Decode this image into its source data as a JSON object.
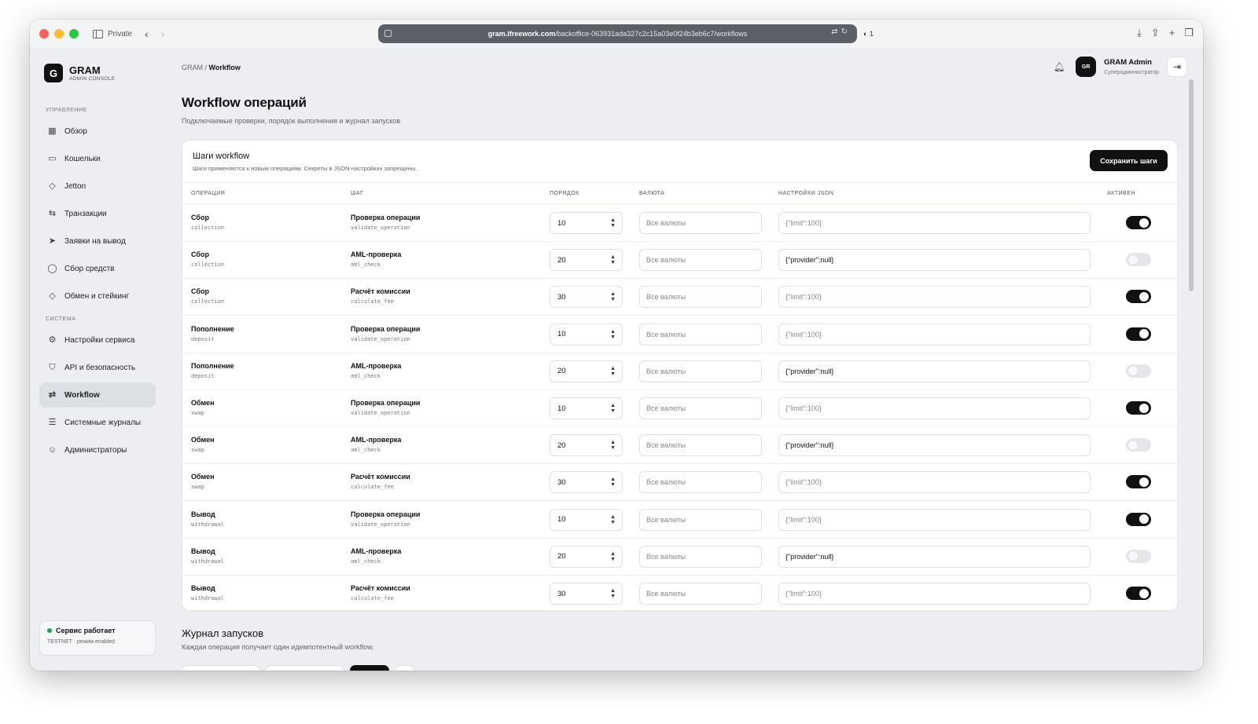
{
  "browser": {
    "tab_label": "Private",
    "url_host": "gram.ifreework.com",
    "url_path": "/backoffice-063931ada327c2c15a03e0f24b3eb6c7/workflows",
    "shield_count": "1"
  },
  "brand": {
    "logo_letter": "G",
    "name": "GRAM",
    "subtitle": "ADMIN CONSOLE"
  },
  "sidebar": {
    "section_manage": "УПРАВЛЕНИЕ",
    "section_system": "СИСТЕМА",
    "items": [
      {
        "label": "Обзор",
        "icon": "grid-icon"
      },
      {
        "label": "Кошельки",
        "icon": "wallet-icon"
      },
      {
        "label": "Jetton",
        "icon": "diamond-icon"
      },
      {
        "label": "Транзакции",
        "icon": "arrows-icon"
      },
      {
        "label": "Заявки на вывод",
        "icon": "send-icon"
      },
      {
        "label": "Сбор средств",
        "icon": "circle-icon"
      },
      {
        "label": "Обмен и стейкинг",
        "icon": "diamond-icon"
      },
      {
        "label": "Настройки сервиса",
        "icon": "gear-icon"
      },
      {
        "label": "API и безопасность",
        "icon": "shield-icon"
      },
      {
        "label": "Workflow",
        "icon": "workflow-icon"
      },
      {
        "label": "Системные журналы",
        "icon": "document-icon"
      },
      {
        "label": "Администраторы",
        "icon": "users-icon"
      }
    ],
    "active_item": "Workflow",
    "status": {
      "title": "Сервис работает",
      "subtitle": "TESTNET · режим enabled",
      "color": "#19a35b"
    }
  },
  "header": {
    "breadcrumb_root": "GRAM",
    "breadcrumb_sep": " / ",
    "breadcrumb_current": "Workflow",
    "admin_initials": "GR",
    "admin_name": "GRAM Admin",
    "admin_role": "Суперадминистратор"
  },
  "page": {
    "title": "Workflow операций",
    "subtitle": "Подключаемые проверки, порядок выполнения и журнал запусков"
  },
  "steps": {
    "title": "Шаги workflow",
    "subtitle": "Шаги применяются к новым операциям. Секреты в JSON-настройках запрещены.",
    "save_label": "Сохранить шаги",
    "columns": [
      "ОПЕРАЦИЯ",
      "ШАГ",
      "ПОРЯДОК",
      "ВАЛЮТА",
      "НАСТРОЙКИ JSON",
      "АКТИВЕН"
    ],
    "currency_placeholder": "Все валюты",
    "rows": [
      {
        "op": "Сбор",
        "op_code": "collection",
        "step": "Проверка операции",
        "step_code": "validate_operation",
        "order": "10",
        "json": "{\"limit\":100}",
        "json_is_placeholder": true,
        "active": true
      },
      {
        "op": "Сбор",
        "op_code": "collection",
        "step": "AML-проверка",
        "step_code": "aml_check",
        "order": "20",
        "json": "{\"provider\":null}",
        "json_is_placeholder": false,
        "active": false
      },
      {
        "op": "Сбор",
        "op_code": "collection",
        "step": "Расчёт комиссии",
        "step_code": "calculate_fee",
        "order": "30",
        "json": "{\"limit\":100}",
        "json_is_placeholder": true,
        "active": true
      },
      {
        "op": "Пополнение",
        "op_code": "deposit",
        "step": "Проверка операции",
        "step_code": "validate_operation",
        "order": "10",
        "json": "{\"limit\":100}",
        "json_is_placeholder": true,
        "active": true
      },
      {
        "op": "Пополнение",
        "op_code": "deposit",
        "step": "AML-проверка",
        "step_code": "aml_check",
        "order": "20",
        "json": "{\"provider\":null}",
        "json_is_placeholder": false,
        "active": false
      },
      {
        "op": "Обмен",
        "op_code": "swap",
        "step": "Проверка операции",
        "step_code": "validate_operation",
        "order": "10",
        "json": "{\"limit\":100}",
        "json_is_placeholder": true,
        "active": true
      },
      {
        "op": "Обмен",
        "op_code": "swap",
        "step": "AML-проверка",
        "step_code": "aml_check",
        "order": "20",
        "json": "{\"provider\":null}",
        "json_is_placeholder": false,
        "active": false
      },
      {
        "op": "Обмен",
        "op_code": "swap",
        "step": "Расчёт комиссии",
        "step_code": "calculate_fee",
        "order": "30",
        "json": "{\"limit\":100}",
        "json_is_placeholder": true,
        "active": true
      },
      {
        "op": "Вывод",
        "op_code": "withdrawal",
        "step": "Проверка операции",
        "step_code": "validate_operation",
        "order": "10",
        "json": "{\"limit\":100}",
        "json_is_placeholder": true,
        "active": true
      },
      {
        "op": "Вывод",
        "op_code": "withdrawal",
        "step": "AML-проверка",
        "step_code": "aml_check",
        "order": "20",
        "json": "{\"provider\":null}",
        "json_is_placeholder": false,
        "active": false
      },
      {
        "op": "Вывод",
        "op_code": "withdrawal",
        "step": "Расчёт комиссии",
        "step_code": "calculate_fee",
        "order": "30",
        "json": "{\"limit\":100}",
        "json_is_placeholder": true,
        "active": true
      }
    ]
  },
  "log": {
    "title": "Журнал запусков",
    "subtitle": "Каждая операция получает один идемпотентный workflow."
  }
}
